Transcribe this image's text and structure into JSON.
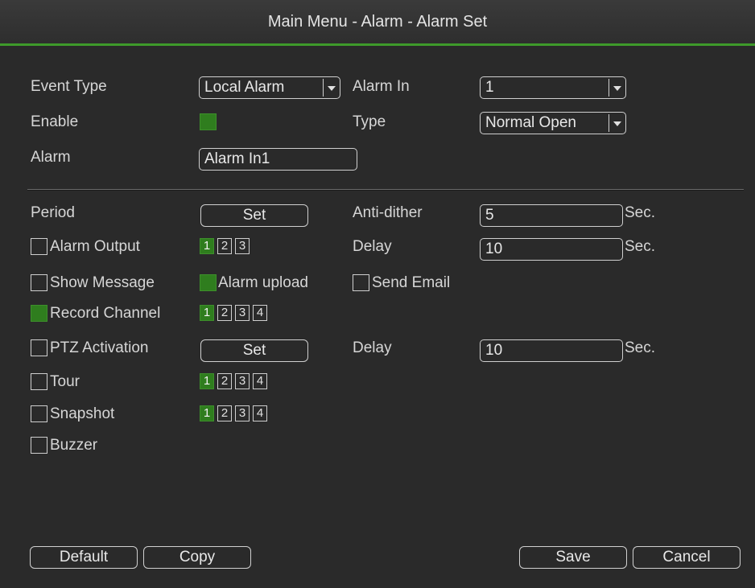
{
  "window": {
    "title": "Main Menu - Alarm - Alarm Set"
  },
  "form": {
    "event_type": {
      "label": "Event Type",
      "value": "Local Alarm"
    },
    "alarm_in": {
      "label": "Alarm In",
      "value": "1"
    },
    "enable": {
      "label": "Enable",
      "checked": true
    },
    "type": {
      "label": "Type",
      "value": "Normal Open"
    },
    "alarm": {
      "label": "Alarm",
      "value": "Alarm In1"
    },
    "period": {
      "label": "Period",
      "button": "Set"
    },
    "anti_dither": {
      "label": "Anti-dither",
      "value": "5",
      "unit": "Sec."
    },
    "alarm_output": {
      "label": "Alarm Output",
      "checked": false,
      "channels": [
        {
          "n": "1",
          "on": true
        },
        {
          "n": "2",
          "on": false
        },
        {
          "n": "3",
          "on": false
        }
      ]
    },
    "delay1": {
      "label": "Delay",
      "value": "10",
      "unit": "Sec."
    },
    "show_message": {
      "label": "Show Message",
      "checked": false
    },
    "alarm_upload": {
      "label": "Alarm upload",
      "checked": true
    },
    "send_email": {
      "label": "Send Email",
      "checked": false
    },
    "record_channel": {
      "label": "Record Channel",
      "checked": true,
      "channels": [
        {
          "n": "1",
          "on": true
        },
        {
          "n": "2",
          "on": false
        },
        {
          "n": "3",
          "on": false
        },
        {
          "n": "4",
          "on": false
        }
      ]
    },
    "ptz_activation": {
      "label": "PTZ Activation",
      "checked": false,
      "button": "Set"
    },
    "delay2": {
      "label": "Delay",
      "value": "10",
      "unit": "Sec."
    },
    "tour": {
      "label": "Tour",
      "checked": false,
      "channels": [
        {
          "n": "1",
          "on": true
        },
        {
          "n": "2",
          "on": false
        },
        {
          "n": "3",
          "on": false
        },
        {
          "n": "4",
          "on": false
        }
      ]
    },
    "snapshot": {
      "label": "Snapshot",
      "checked": false,
      "channels": [
        {
          "n": "1",
          "on": true
        },
        {
          "n": "2",
          "on": false
        },
        {
          "n": "3",
          "on": false
        },
        {
          "n": "4",
          "on": false
        }
      ]
    },
    "buzzer": {
      "label": "Buzzer",
      "checked": false
    }
  },
  "buttons": {
    "default": "Default",
    "copy": "Copy",
    "save": "Save",
    "cancel": "Cancel"
  },
  "colors": {
    "accent": "#3e9a2a",
    "checked": "#2f7d1e",
    "background": "#2a2a2a"
  }
}
